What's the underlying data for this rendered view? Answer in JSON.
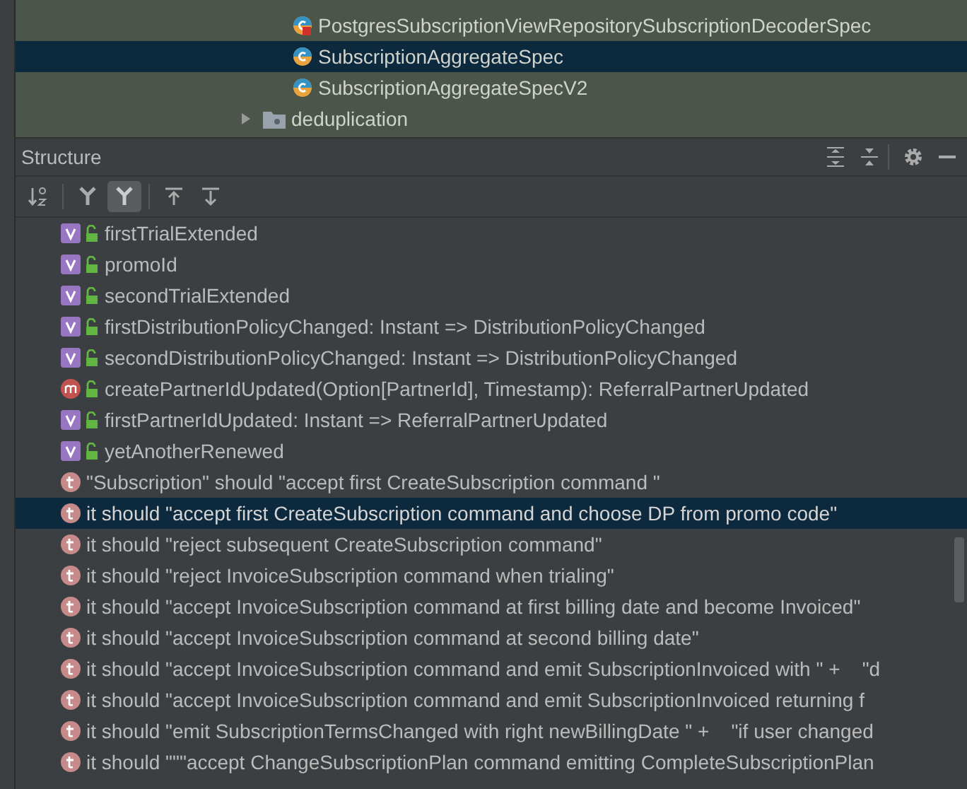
{
  "project_tree": {
    "items": [
      {
        "kind": "class",
        "label": "PostgresSubscriptionViewRepositorySubscriptionDecoderSpec",
        "selected": false,
        "failed": true
      },
      {
        "kind": "class",
        "label": "SubscriptionAggregateSpec",
        "selected": true,
        "failed": false
      },
      {
        "kind": "class",
        "label": "SubscriptionAggregateSpecV2",
        "selected": false,
        "failed": false
      },
      {
        "kind": "folder",
        "label": "deduplication",
        "selected": false,
        "expanded": false
      }
    ]
  },
  "structure": {
    "title": "Structure",
    "header_tools": [
      {
        "kind": "expand-all"
      },
      {
        "kind": "collapse-all"
      },
      {
        "kind": "settings"
      },
      {
        "kind": "minimize"
      }
    ],
    "toolbar": [
      {
        "kind": "sort",
        "on": false
      },
      {
        "kind": "fields",
        "on": false
      },
      {
        "kind": "inherited",
        "on": true
      },
      {
        "kind": "navigate-up",
        "on": false
      },
      {
        "kind": "navigate-down",
        "on": false
      }
    ],
    "items": [
      {
        "kind": "value",
        "label": "firstTrialExtended",
        "selected": false
      },
      {
        "kind": "value",
        "label": "promoId",
        "selected": false
      },
      {
        "kind": "value",
        "label": "secondTrialExtended",
        "selected": false
      },
      {
        "kind": "value",
        "label": "firstDistributionPolicyChanged: Instant => DistributionPolicyChanged",
        "selected": false
      },
      {
        "kind": "value",
        "label": "secondDistributionPolicyChanged: Instant => DistributionPolicyChanged",
        "selected": false
      },
      {
        "kind": "method",
        "label": "createPartnerIdUpdated(Option[PartnerId], Timestamp): ReferralPartnerUpdated",
        "selected": false
      },
      {
        "kind": "value",
        "label": "firstPartnerIdUpdated: Instant => ReferralPartnerUpdated",
        "selected": false
      },
      {
        "kind": "value",
        "label": "yetAnotherRenewed",
        "selected": false
      },
      {
        "kind": "test",
        "label": "\"Subscription\" should \"accept first CreateSubscription command \"",
        "selected": false
      },
      {
        "kind": "test",
        "label": "it should \"accept first CreateSubscription command and choose DP from promo code\"",
        "selected": true
      },
      {
        "kind": "test",
        "label": "it should \"reject subsequent CreateSubscription command\"",
        "selected": false
      },
      {
        "kind": "test",
        "label": "it should \"reject InvoiceSubscription command when trialing\"",
        "selected": false
      },
      {
        "kind": "test",
        "label": "it should \"accept InvoiceSubscription command at first billing date and become Invoiced\"",
        "selected": false
      },
      {
        "kind": "test",
        "label": "it should \"accept InvoiceSubscription command at second billing date\"",
        "selected": false
      },
      {
        "kind": "test",
        "label": "it should \"accept InvoiceSubscription command and emit SubscriptionInvoiced with \" +    \"d",
        "selected": false
      },
      {
        "kind": "test",
        "label": "it should \"accept InvoiceSubscription command and emit SubscriptionInvoiced returning f",
        "selected": false
      },
      {
        "kind": "test",
        "label": "it should \"emit SubscriptionTermsChanged with right newBillingDate \" +    \"if user changed",
        "selected": false
      },
      {
        "kind": "test",
        "label": "it should \"\"\"accept ChangeSubscriptionPlan command emitting CompleteSubscriptionPlan",
        "selected": false
      }
    ]
  }
}
